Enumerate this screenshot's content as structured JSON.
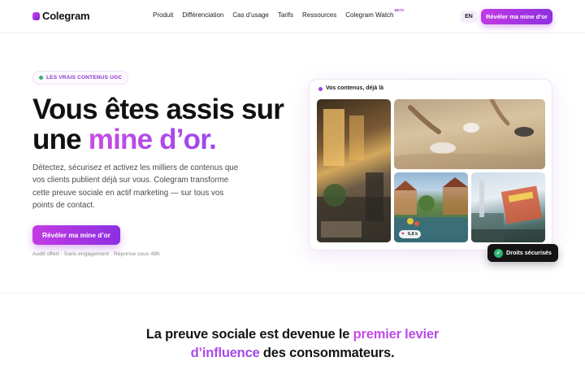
{
  "nav": {
    "logo_text": "Colegram",
    "links": [
      "Produit",
      "Différenciation",
      "Cas d’usage",
      "Tarifs",
      "Ressources",
      "Colegram Watch"
    ],
    "beta_label": "BETA",
    "lang_label": "EN",
    "cta_label": "Révéler ma mine d’or"
  },
  "hero": {
    "badge": "LES VRAIS CONTENUS UGC",
    "title_line1": "Vous êtes assis sur",
    "title_line2_plain": "une ",
    "title_line2_accent": "mine d’or.",
    "description": "Détectez, sécurisez et activez les milliers de contenus que vos clients publient déjà sur vous. Colegram transforme cette preuve sociale en actif marketing — sur tous vos points de contact.",
    "cta_label": "Révéler ma mine d’or",
    "note": "Audit offert · Sans engagement · Réponse sous 48h"
  },
  "gallery": {
    "header": "Vos contenus, déjà là",
    "like_count": "6,8 k",
    "rights_label": "Droits sécurisés"
  },
  "section": {
    "title_part1": "La preuve sociale est devenue le ",
    "title_accent": "premier levier d’influence",
    "title_part2": " des consommateurs."
  },
  "colors": {
    "accent": "#b03be3",
    "success": "#2bb673",
    "dark_badge": "#141414"
  },
  "icons": {
    "logo": "logo-mark-icon",
    "check": "check-icon",
    "heart": "heart-icon",
    "dot": "status-dot-icon"
  }
}
